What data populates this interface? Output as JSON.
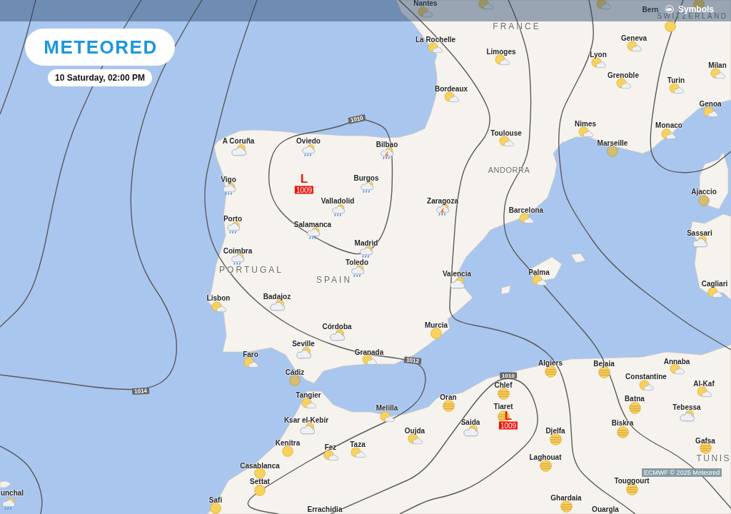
{
  "top_bar": {
    "symbols_button": "Symbols"
  },
  "logo": "METEORED",
  "date": "10 Saturday, 02:00 PM",
  "countries": [
    "SWITZERLAND",
    "FRANCE",
    "ANDORRA",
    "PORTUGAL",
    "SPAIN",
    "TUNIS"
  ],
  "cities": [
    {
      "name": "Nantes",
      "kind": "partly_cloudy"
    },
    {
      "kind": "partly_cloudy"
    },
    {
      "kind": "partly_cloudy"
    },
    {
      "name": "Bern",
      "kind": "sunny"
    },
    {
      "kind": "sunny"
    },
    {
      "name": "La Rochelle",
      "kind": "partly_cloudy"
    },
    {
      "name": "Geneva",
      "kind": "partly_cloudy"
    },
    {
      "name": "Limoges",
      "kind": "partly_cloudy"
    },
    {
      "name": "Lyon",
      "kind": "partly_cloudy"
    },
    {
      "name": "Milan",
      "kind": "partly_cloudy"
    },
    {
      "name": "Grenoble",
      "kind": "partly_cloudy"
    },
    {
      "name": "Turin",
      "kind": "partly_cloudy"
    },
    {
      "name": "Bordeaux",
      "kind": "partly_cloudy"
    },
    {
      "name": "Genoa",
      "kind": "partly_cloudy"
    },
    {
      "name": "Nimes",
      "kind": "partly_cloudy"
    },
    {
      "name": "Monaco",
      "kind": "partly_cloudy"
    },
    {
      "name": "Toulouse",
      "kind": "partly_cloudy"
    },
    {
      "name": "A Coruña",
      "kind": "cloudy"
    },
    {
      "name": "Oviedo",
      "kind": "rain"
    },
    {
      "name": "Bilbao",
      "kind": "storm"
    },
    {
      "name": "Marseille",
      "kind": "dim_sun"
    },
    {
      "name": "Vigo",
      "kind": "rain"
    },
    {
      "name": "Burgos",
      "kind": "rain"
    },
    {
      "name": "Ajaccio",
      "kind": "dim_sun"
    },
    {
      "name": "Valladolid",
      "kind": "rain"
    },
    {
      "name": "Zaragoza",
      "kind": "storm"
    },
    {
      "name": "Barcelona",
      "kind": "partly_cloudy"
    },
    {
      "name": "Porto",
      "kind": "rain"
    },
    {
      "name": "Salamanca",
      "kind": "rain"
    },
    {
      "name": "Sassari",
      "kind": "cloudy"
    },
    {
      "name": "Madrid",
      "kind": "rain"
    },
    {
      "name": "Coimbra",
      "kind": "rain"
    },
    {
      "name": "Toledo",
      "kind": "rain"
    },
    {
      "name": "Valencia",
      "kind": "cloudy"
    },
    {
      "name": "Palma",
      "kind": "partly_cloudy"
    },
    {
      "name": "Cagliari",
      "kind": "partly_cloudy"
    },
    {
      "name": "Lisbon",
      "kind": "partly_cloudy"
    },
    {
      "name": "Badajoz",
      "kind": "cloudy"
    },
    {
      "name": "Córdoba",
      "kind": "cloudy"
    },
    {
      "name": "Murcia",
      "kind": "sunny"
    },
    {
      "name": "Seville",
      "kind": "cloudy"
    },
    {
      "name": "Faro",
      "kind": "partly_cloudy"
    },
    {
      "name": "Granada",
      "kind": "partly_cloudy"
    },
    {
      "name": "Algiers",
      "kind": "haze"
    },
    {
      "name": "Bejaia",
      "kind": "haze"
    },
    {
      "name": "Annaba",
      "kind": "partly_cloudy"
    },
    {
      "name": "Cádiz",
      "kind": "dim_sun"
    },
    {
      "name": "Constantine",
      "kind": "partly_cloudy"
    },
    {
      "name": "Chlef",
      "kind": "haze"
    },
    {
      "name": "Al-Kaf",
      "kind": "partly_cloudy"
    },
    {
      "name": "Tangier",
      "kind": "partly_cloudy"
    },
    {
      "name": "Oran",
      "kind": "haze"
    },
    {
      "name": "Batna",
      "kind": "haze"
    },
    {
      "name": "Melilla",
      "kind": "partly_cloudy"
    },
    {
      "name": "Tiaret",
      "kind": "haze"
    },
    {
      "name": "Tebessa",
      "kind": "cloudy"
    },
    {
      "name": "Ksar el-Kebir",
      "kind": "cloudy"
    },
    {
      "name": "Saida",
      "kind": "cloudy"
    },
    {
      "name": "Biskra",
      "kind": "haze"
    },
    {
      "name": "Oujda",
      "kind": "partly_cloudy"
    },
    {
      "name": "Djelfa",
      "kind": "haze"
    },
    {
      "name": "Kenitra",
      "kind": "sunny"
    },
    {
      "name": "Fez",
      "kind": "partly_cloudy"
    },
    {
      "name": "Taza",
      "kind": "partly_cloudy"
    },
    {
      "name": "Gafsa",
      "kind": "haze"
    },
    {
      "name": "Laghouat",
      "kind": "haze"
    },
    {
      "name": "Casablanca",
      "kind": "sunny"
    },
    {
      "name": "Settat",
      "kind": "sunny"
    },
    {
      "name": "Touggourt",
      "kind": "haze"
    },
    {
      "name": "unchal",
      "kind": "rain"
    },
    {
      "name": "Safi",
      "kind": "sunny"
    },
    {
      "name": "Ghardaia",
      "kind": "haze"
    },
    {
      "name": "Errachidia"
    },
    {
      "name": "Ouargla"
    }
  ],
  "isobar_labels": [
    "1010",
    "1012",
    "1010",
    "1014"
  ],
  "lows": [
    {
      "symbol": "L",
      "pressure": "1009"
    },
    {
      "symbol": "L",
      "pressure": "1009"
    }
  ],
  "credit": "ECMWF © 2025 Meteored"
}
